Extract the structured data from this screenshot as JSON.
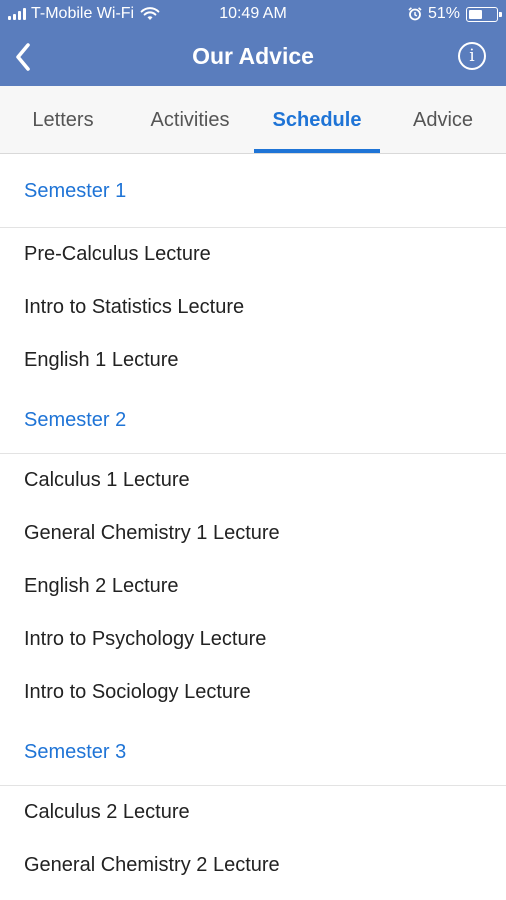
{
  "status_bar": {
    "carrier": "T-Mobile Wi-Fi",
    "time": "10:49 AM",
    "battery": "51%",
    "battery_level": 0.51
  },
  "nav": {
    "title": "Our Advice",
    "back_icon": "chevron-left-icon",
    "info_icon": "info-icon",
    "info_glyph": "i"
  },
  "tabs": [
    {
      "label": "Letters",
      "active": false
    },
    {
      "label": "Activities",
      "active": false
    },
    {
      "label": "Schedule",
      "active": true
    },
    {
      "label": "Advice",
      "active": false
    }
  ],
  "sections": [
    {
      "title": "Semester 1",
      "items": [
        "Pre-Calculus Lecture",
        "Intro to Statistics Lecture",
        "English 1 Lecture"
      ]
    },
    {
      "title": "Semester 2",
      "items": [
        "Calculus 1 Lecture",
        "General Chemistry 1 Lecture",
        "English 2 Lecture",
        "Intro to Psychology Lecture",
        "Intro to Sociology Lecture"
      ]
    },
    {
      "title": "Semester 3",
      "items": [
        "Calculus 2 Lecture",
        "General Chemistry 2 Lecture"
      ]
    }
  ],
  "colors": {
    "header_bg": "#5a7dbd",
    "accent": "#1f74d6"
  }
}
